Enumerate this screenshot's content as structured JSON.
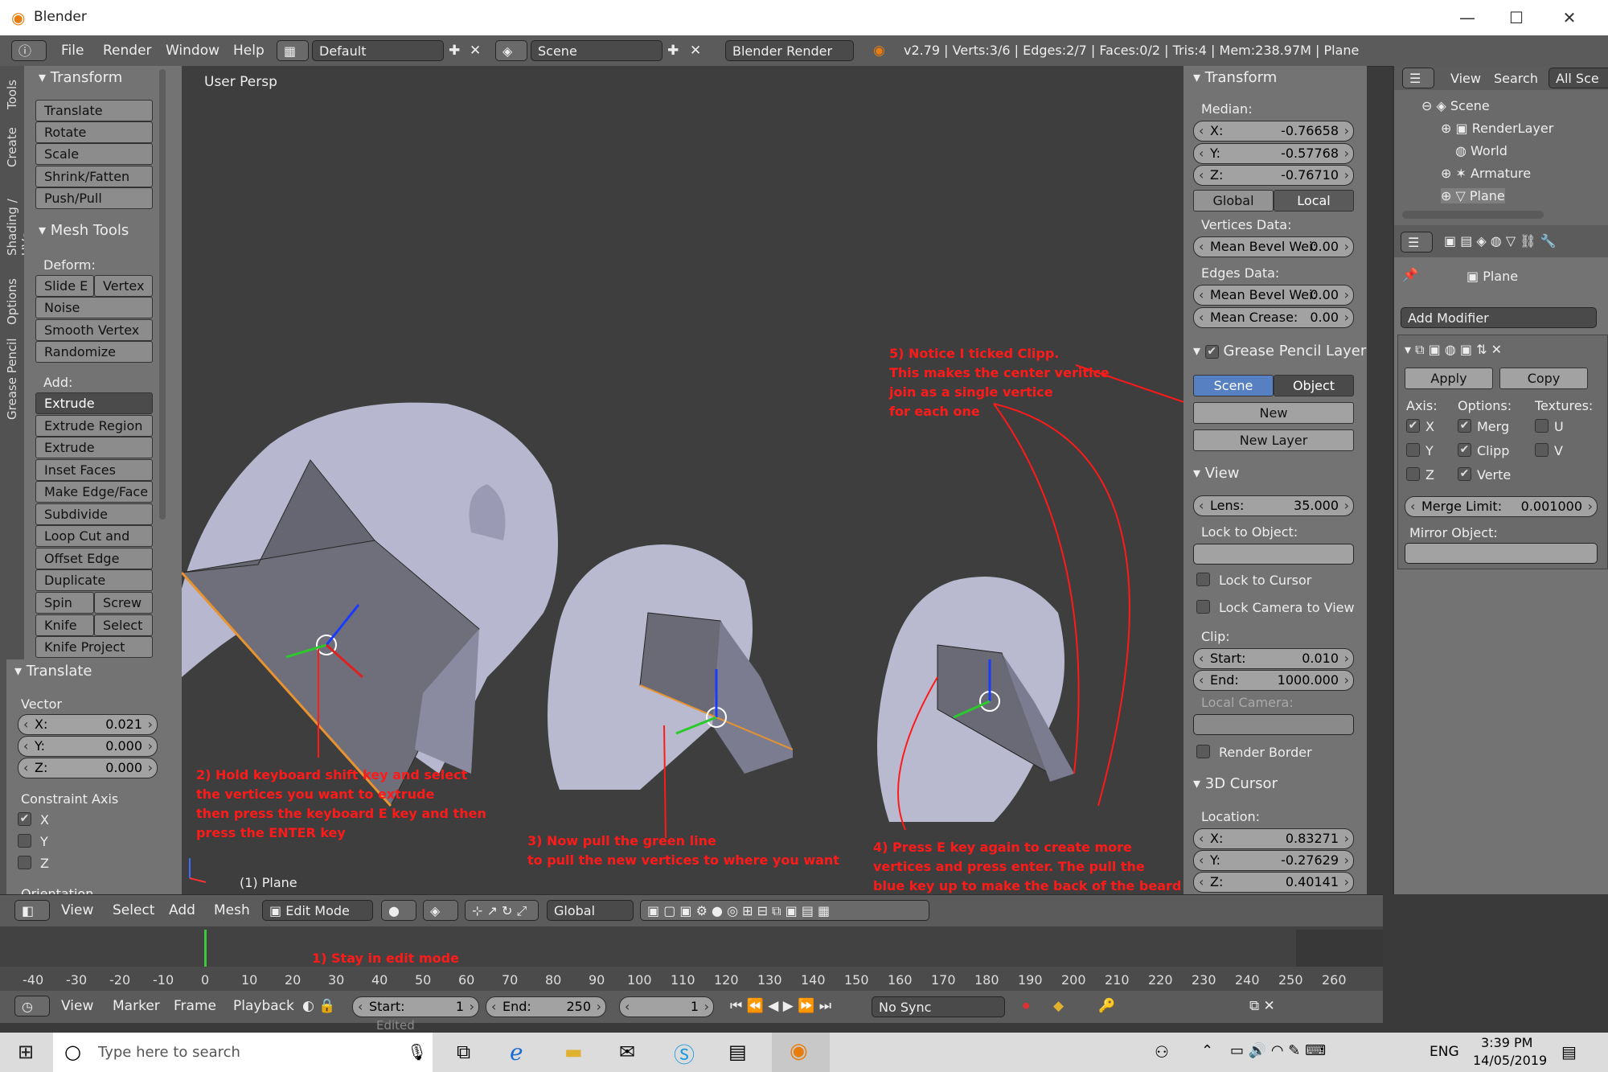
{
  "window": {
    "title": "Blender",
    "minimize": "—",
    "maximize": "☐",
    "close": "✕"
  },
  "menubar": {
    "menus": [
      "File",
      "Render",
      "Window",
      "Help"
    ],
    "layout": "Default",
    "scene": "Scene",
    "engine": "Blender Render",
    "stats": "v2.79 | Verts:3/6 | Edges:2/7 | Faces:0/2 | Tris:4 | Mem:238.97M | Plane"
  },
  "tool_tabs": [
    "Tools",
    "Create",
    "Shading / UVs",
    "Options",
    "Grease Pencil"
  ],
  "toolshelf": {
    "transform_header": "Transform",
    "transform_buttons": [
      "Translate",
      "Rotate",
      "Scale",
      "Shrink/Fatten",
      "Push/Pull"
    ],
    "mesh_tools_header": "Mesh Tools",
    "deform_label": "Deform:",
    "slide_e": "Slide E",
    "vertex": "Vertex",
    "deform_buttons": [
      "Noise",
      "Smooth Vertex",
      "Randomize"
    ],
    "add_label": "Add:",
    "extrude": "Extrude",
    "add_buttons": [
      "Extrude Region",
      "Extrude Individ...",
      "Inset Faces",
      "Make Edge/Face",
      "Subdivide",
      "Loop Cut and Sl...",
      "Offset Edge Slide",
      "Duplicate"
    ],
    "spin": "Spin",
    "screw": "Screw",
    "knife": "Knife",
    "select": "Select",
    "knife_project": "Knife Project"
  },
  "operator": {
    "header": "Translate",
    "vector_label": "Vector",
    "x_label": "X:",
    "x_value": "0.021",
    "y_label": "Y:",
    "y_value": "0.000",
    "z_label": "Z:",
    "z_value": "0.000",
    "constraint_label": "Constraint Axis",
    "axes": [
      "X",
      "Y",
      "Z"
    ],
    "orientation_label": "Orientation"
  },
  "viewport": {
    "persp_label": "User Persp",
    "object_label": "(1) Plane"
  },
  "annotations": {
    "note1": "1) Stay in edit mode",
    "note2": "2) Hold keyboard shift key and select\nthe vertices you want to extrude\nthen press the keyboard E key and then\npress the ENTER key",
    "note3": "3) Now pull the green line\nto pull the new vertices to where you want",
    "note4": "4) Press E key again to create more\nvertices and press enter. The pull the\nblue key up to make the back of the beard",
    "note5": "5) Notice I ticked Clipp.\nThis makes the center veritice\njoin as a single vertice\nfor each one"
  },
  "properties": {
    "transform_header": "Transform",
    "median_label": "Median:",
    "x_label": "X:",
    "x_value": "-0.76658",
    "y_label": "Y:",
    "y_value": "-0.57768",
    "z_label": "Z:",
    "z_value": "-0.76710",
    "global": "Global",
    "local": "Local",
    "vertices_data": "Vertices Data:",
    "mean_bevel_v_label": "Mean Bevel Wei:",
    "mean_bevel_v_value": "0.00",
    "edges_data": "Edges Data:",
    "mean_bevel_e_label": "Mean Bevel Wei:",
    "mean_bevel_e_value": "0.00",
    "mean_crease_label": "Mean Crease:",
    "mean_crease_value": "0.00",
    "grease_header": "Grease Pencil Layer",
    "scene": "Scene",
    "object": "Object",
    "new": "New",
    "new_layer": "New Layer",
    "view_header": "View",
    "lens_label": "Lens:",
    "lens_value": "35.000",
    "lock_to_object": "Lock to Object:",
    "lock_to_cursor": "Lock to Cursor",
    "lock_camera": "Lock Camera to View",
    "clip_label": "Clip:",
    "start_label": "Start:",
    "start_value": "0.010",
    "end_label": "End:",
    "end_value": "1000.000",
    "local_camera": "Local Camera:",
    "render_border": "Render Border",
    "cursor_header": "3D Cursor",
    "location_label": "Location:",
    "cx_label": "X:",
    "cx_value": "0.83271",
    "cy_label": "Y:",
    "cy_value": "-0.27629",
    "cz_label": "Z:",
    "cz_value": "0.40141"
  },
  "outliner": {
    "view": "View",
    "search": "Search",
    "filter": "All Sce",
    "items": [
      "Scene",
      "RenderLayer",
      "World",
      "Armature",
      "Plane"
    ]
  },
  "modifiers": {
    "object_name": "Plane",
    "add_modifier": "Add Modifier",
    "apply": "Apply",
    "copy": "Copy",
    "axis_label": "Axis:",
    "options_label": "Options:",
    "textures_label": "Textures:",
    "x": "X",
    "y": "Y",
    "z": "Z",
    "merge": "Merg",
    "clipping": "Clipp",
    "vertex_groups": "Verte",
    "u": "U",
    "v": "V",
    "merge_limit_label": "Merge Limit:",
    "merge_limit_value": "0.001000",
    "mirror_object": "Mirror Object:"
  },
  "header3d": {
    "menus": [
      "View",
      "Select",
      "Add",
      "Mesh"
    ],
    "mode": "Edit Mode",
    "orientation": "Global"
  },
  "timeline": {
    "ticks": [
      "-40",
      "-30",
      "-20",
      "-10",
      "0",
      "10",
      "20",
      "30",
      "40",
      "50",
      "60",
      "70",
      "80",
      "90",
      "100",
      "110",
      "120",
      "130",
      "140",
      "150",
      "160",
      "170",
      "180",
      "190",
      "200",
      "210",
      "220",
      "230",
      "240",
      "250",
      "260"
    ],
    "menus": [
      "View",
      "Marker",
      "Frame",
      "Playback"
    ],
    "start_label": "Start:",
    "start_value": "1",
    "end_label": "End:",
    "end_value": "250",
    "current": "1",
    "sync": "No Sync",
    "edited": "Edited"
  },
  "taskbar": {
    "search_placeholder": "Type here to search",
    "lang": "ENG",
    "time": "3:39 PM",
    "date": "14/05/2019"
  }
}
